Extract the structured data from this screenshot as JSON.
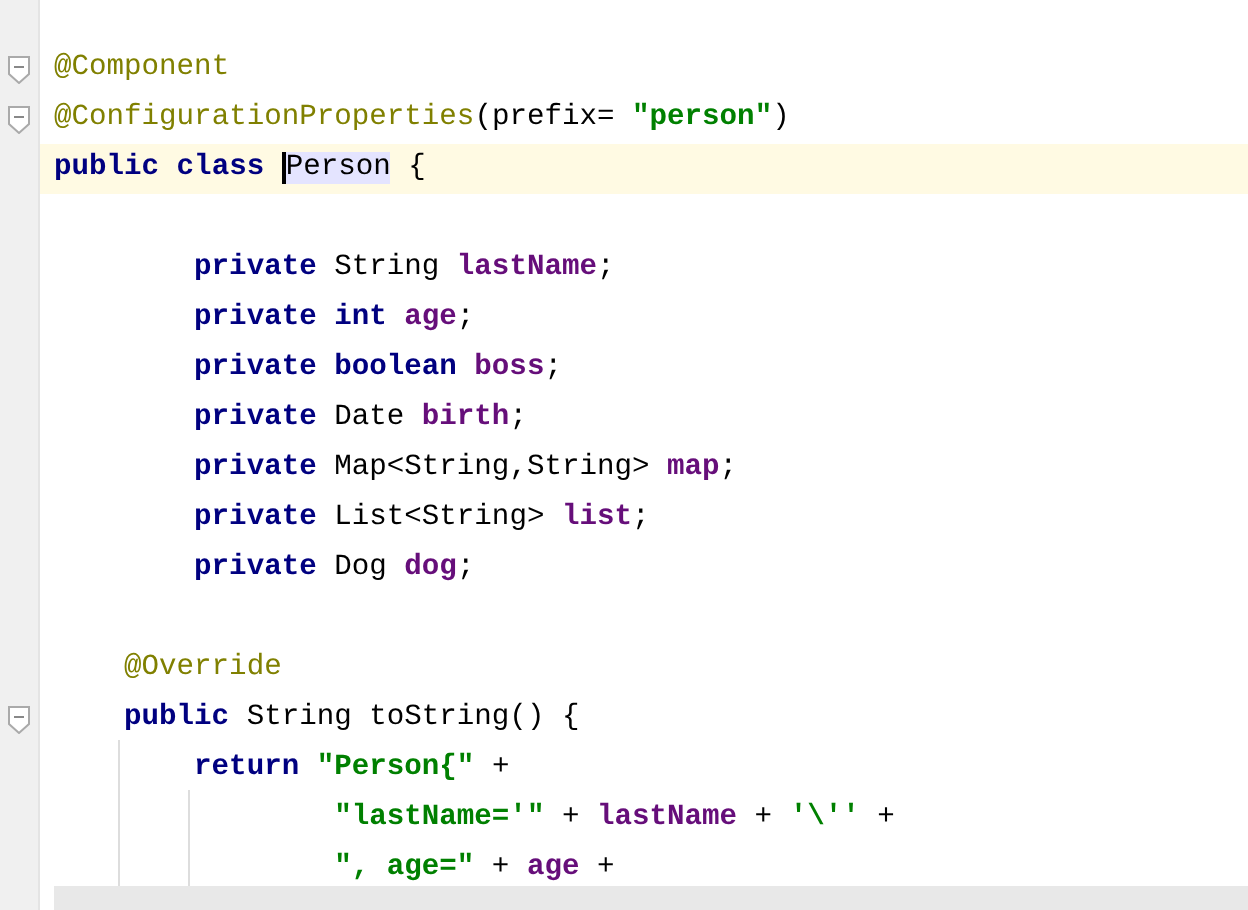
{
  "editor": {
    "lines": [
      {
        "current": false,
        "fold": true,
        "tokens": [
          {
            "kind": "annotation",
            "text": "@Component"
          }
        ]
      },
      {
        "current": false,
        "fold": true,
        "tokens": [
          {
            "kind": "annotation",
            "text": "@ConfigurationProperties"
          },
          {
            "kind": "plain",
            "text": "(prefix= "
          },
          {
            "kind": "string",
            "text": "\"person\""
          },
          {
            "kind": "plain",
            "text": ")"
          }
        ]
      },
      {
        "current": true,
        "fold": false,
        "tokens": [
          {
            "kind": "keyword",
            "text": "public class "
          },
          {
            "kind": "caret-word",
            "text": "Person"
          },
          {
            "kind": "plain",
            "text": " {"
          }
        ]
      },
      {
        "current": false,
        "fold": false
      },
      {
        "current": false,
        "fold": false,
        "tokens": [
          {
            "kind": "keyword",
            "text": "        private"
          },
          {
            "kind": "plain",
            "text": " String "
          },
          {
            "kind": "field",
            "text": "lastName"
          },
          {
            "kind": "plain",
            "text": ";"
          }
        ]
      },
      {
        "current": false,
        "fold": false,
        "tokens": [
          {
            "kind": "keyword",
            "text": "        private int "
          },
          {
            "kind": "field",
            "text": "age"
          },
          {
            "kind": "plain",
            "text": ";"
          }
        ]
      },
      {
        "current": false,
        "fold": false,
        "tokens": [
          {
            "kind": "keyword",
            "text": "        private boolean "
          },
          {
            "kind": "field",
            "text": "boss"
          },
          {
            "kind": "plain",
            "text": ";"
          }
        ]
      },
      {
        "current": false,
        "fold": false,
        "tokens": [
          {
            "kind": "keyword",
            "text": "        private"
          },
          {
            "kind": "plain",
            "text": " Date "
          },
          {
            "kind": "field",
            "text": "birth"
          },
          {
            "kind": "plain",
            "text": ";"
          }
        ]
      },
      {
        "current": false,
        "fold": false,
        "tokens": [
          {
            "kind": "keyword",
            "text": "        private"
          },
          {
            "kind": "plain",
            "text": " Map<String,String> "
          },
          {
            "kind": "field",
            "text": "map"
          },
          {
            "kind": "plain",
            "text": ";"
          }
        ]
      },
      {
        "current": false,
        "fold": false,
        "tokens": [
          {
            "kind": "keyword",
            "text": "        private"
          },
          {
            "kind": "plain",
            "text": " List<String> "
          },
          {
            "kind": "field",
            "text": "list"
          },
          {
            "kind": "plain",
            "text": ";"
          }
        ]
      },
      {
        "current": false,
        "fold": false,
        "tokens": [
          {
            "kind": "keyword",
            "text": "        private"
          },
          {
            "kind": "plain",
            "text": " Dog "
          },
          {
            "kind": "field",
            "text": "dog"
          },
          {
            "kind": "plain",
            "text": ";"
          }
        ]
      },
      {
        "current": false,
        "fold": false
      },
      {
        "current": false,
        "fold": false,
        "tokens": [
          {
            "kind": "annotation",
            "text": "    @Override"
          }
        ]
      },
      {
        "current": false,
        "fold": true,
        "tokens": [
          {
            "kind": "keyword",
            "text": "    public"
          },
          {
            "kind": "plain",
            "text": " String toString() {"
          }
        ]
      },
      {
        "current": false,
        "fold": false,
        "tokens": [
          {
            "kind": "keyword",
            "text": "        return "
          },
          {
            "kind": "string",
            "text": "\"Person{\""
          },
          {
            "kind": "plain",
            "text": " +"
          }
        ]
      },
      {
        "current": false,
        "fold": false,
        "tokens": [
          {
            "kind": "string",
            "text": "                \"lastName='\""
          },
          {
            "kind": "plain",
            "text": " + "
          },
          {
            "kind": "field",
            "text": "lastName"
          },
          {
            "kind": "plain",
            "text": " + "
          },
          {
            "kind": "string",
            "text": "'\\''"
          },
          {
            "kind": "plain",
            "text": " +"
          }
        ]
      },
      {
        "current": false,
        "fold": false,
        "tokens": [
          {
            "kind": "string",
            "text": "                \", age=\""
          },
          {
            "kind": "plain",
            "text": " + "
          },
          {
            "kind": "field",
            "text": "age"
          },
          {
            "kind": "plain",
            "text": " +"
          }
        ]
      }
    ]
  }
}
